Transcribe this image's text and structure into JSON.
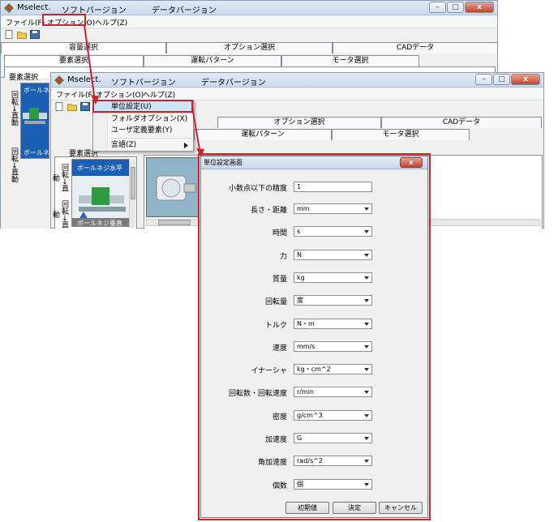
{
  "back_window": {
    "title": "Mselect.",
    "software_version_label": "ソフトバージョン",
    "data_version_label": "データバージョン",
    "menu": [
      {
        "label": "ファイル(F)"
      },
      {
        "label": "オプション(O)"
      },
      {
        "label": "ヘルプ(Z)"
      }
    ],
    "tabs_row1": [
      {
        "label": "容量選択"
      },
      {
        "label": "オプション選択"
      },
      {
        "label": "CADデータ"
      }
    ],
    "tabs_row2": [
      {
        "label": "要素選択"
      },
      {
        "label": "運転パターン"
      },
      {
        "label": "モータ選択"
      }
    ],
    "element_select_label": "要素選択",
    "sidebar_vertical_1": "回転→直動",
    "sidebar_vertical_2": "回転→直動",
    "tile_label_1": "ボールネ",
    "tile_label_2": "ボールネ"
  },
  "front_window": {
    "title": "Mselect.",
    "software_version_label": "ソフトバージョン",
    "data_version_label": "データバージョン",
    "menu": [
      {
        "label": "ファイル(F)"
      },
      {
        "label": "オプション(O)"
      },
      {
        "label": "ヘルプ(Z)"
      }
    ],
    "tabs_row1": [
      {
        "label": "オプション選択"
      },
      {
        "label": "CADデータ"
      }
    ],
    "tabs_row2": [
      {
        "label": "運転パターン"
      },
      {
        "label": "モータ選択"
      }
    ],
    "element_select_label": "要素選択",
    "sidebar_vertical_1": "回転→直動",
    "sidebar_vertical_2": "回転→直動",
    "tile_label_1": "ボールネジ水平",
    "tile_label_2": "ボールネジ垂直"
  },
  "options_menu": {
    "items": [
      {
        "label": "単位設定(U)"
      },
      {
        "label": "フォルダオプション(X)"
      },
      {
        "label": "ユーザ定義要素(Y)"
      },
      {
        "label": "言語(Z)"
      }
    ]
  },
  "unit_dialog": {
    "title": "単位設定画面",
    "close_glyph": "x",
    "decimal_label": "小数点以下の精度",
    "decimal_value": "1",
    "fields": [
      {
        "label": "長さ・距離",
        "value": "mm"
      },
      {
        "label": "時間",
        "value": "s"
      },
      {
        "label": "力",
        "value": "N"
      },
      {
        "label": "質量",
        "value": "kg"
      },
      {
        "label": "回転量",
        "value": "度"
      },
      {
        "label": "トルク",
        "value": "N・m"
      },
      {
        "label": "速度",
        "value": "mm/s"
      },
      {
        "label": "イナーシャ",
        "value": "kg・cm^2"
      },
      {
        "label": "回転数・回転速度",
        "value": "r/min"
      },
      {
        "label": "密度",
        "value": "g/cm^3"
      },
      {
        "label": "加速度",
        "value": "G"
      },
      {
        "label": "角加速度",
        "value": "rad/s^2"
      },
      {
        "label": "個数",
        "value": "個"
      }
    ],
    "buttons": {
      "reset": "初期値",
      "ok": "決定",
      "cancel": "キャンセル"
    }
  },
  "colors": {
    "highlight_red": "#d0202a",
    "tile_blue": "#1a5fb4"
  }
}
